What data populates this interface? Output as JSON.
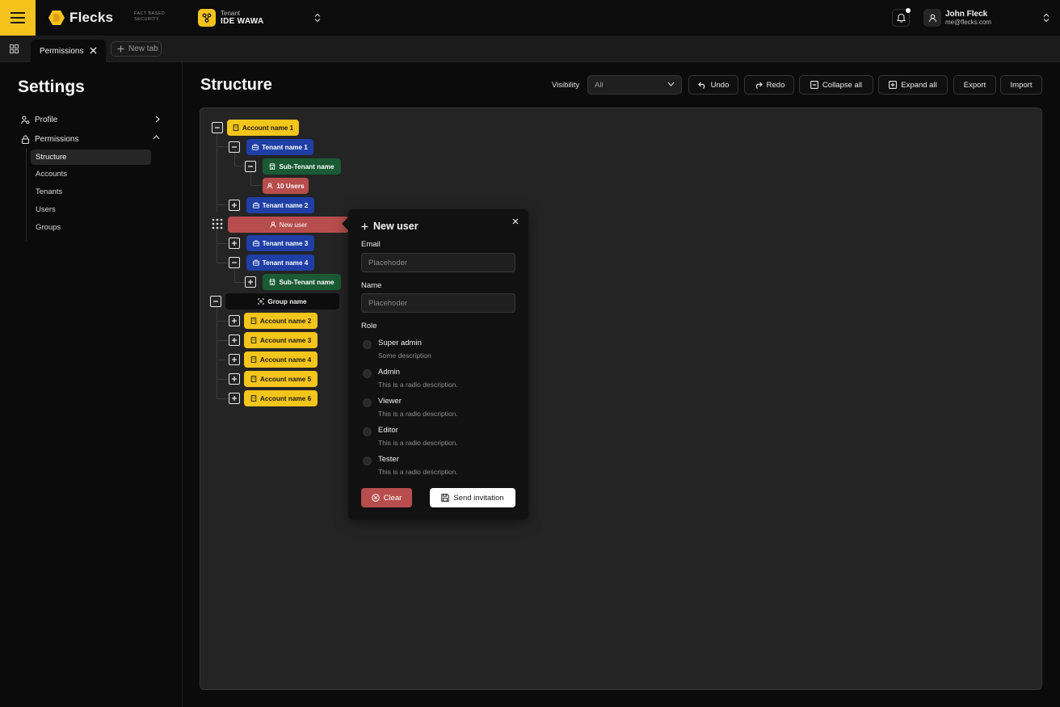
{
  "brand": {
    "name": "Flecks",
    "tagline": "FACT BASED SECURITY",
    "accent": "#f6c21c"
  },
  "tenant": {
    "label": "Tenant",
    "value": "IDE WAWA"
  },
  "user": {
    "name": "John Fleck",
    "email": "me@flecks.com"
  },
  "tabs": {
    "active_label": "Permissions",
    "new_tab_label": "New tab"
  },
  "sidebar": {
    "title": "Settings",
    "items": [
      {
        "label": "Profile",
        "icon": "user-gear-icon"
      },
      {
        "label": "Permissions",
        "icon": "lock-icon"
      }
    ],
    "subitems": [
      "Structure",
      "Accounts",
      "Tenants",
      "Users",
      "Groups"
    ]
  },
  "main": {
    "title": "Structure",
    "visibility_label": "Visibility",
    "visibility_value": "All",
    "buttons": {
      "undo": "Undo",
      "redo": "Redo",
      "collapse": "Collapse all",
      "expand": "Expand all",
      "export": "Export",
      "import": "Import"
    }
  },
  "tree": {
    "account1": "Account name 1",
    "tenant1": "Tenant name 1",
    "subtenant1": "Sub-Tenant name",
    "users": "10 Users",
    "tenant2": "Tenant name 2",
    "newuser": "New user",
    "tenant3": "Tenant name 3",
    "tenant4": "Tenant name 4",
    "subtenant2": "Sub-Tenant name",
    "group": "Group name",
    "accounts": [
      "Account name 2",
      "Account name 3",
      "Account name 4",
      "Account name 5",
      "Account name 6"
    ]
  },
  "popover": {
    "title": "New user",
    "email_label": "Email",
    "email_placeholder": "Placehoder",
    "name_label": "Name",
    "name_placeholder": "Placehoder",
    "role_label": "Role",
    "roles": [
      {
        "label": "Super admin",
        "desc": "Some description"
      },
      {
        "label": "Admin",
        "desc": "This is a radio description."
      },
      {
        "label": "Viewer",
        "desc": "This is a radio description."
      },
      {
        "label": "Editor",
        "desc": "This is a radio description."
      },
      {
        "label": "Tester",
        "desc": "This is a radio description."
      }
    ],
    "clear_label": "Clear",
    "send_label": "Send invitation"
  },
  "colors": {
    "account": "#f4c51a",
    "tenant": "#1f3fa6",
    "subtenant": "#1a5a34",
    "users": "#b74d4d"
  }
}
